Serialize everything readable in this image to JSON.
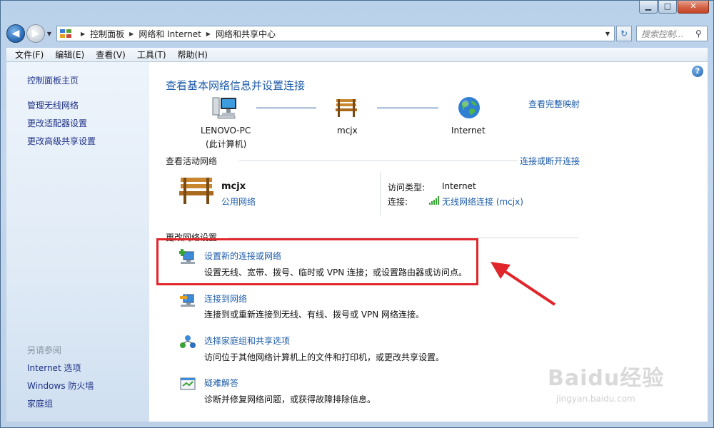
{
  "window": {
    "controls": {
      "minimize": "▁",
      "maximize": "□",
      "close": "✕"
    }
  },
  "navbar": {
    "back": "◀",
    "forward": "▶",
    "breadcrumbs": [
      "控制面板",
      "网络和 Internet",
      "网络和共享中心"
    ],
    "search_placeholder": "搜索控制...",
    "refresh": "↻"
  },
  "menu": [
    "文件(F)",
    "编辑(E)",
    "查看(V)",
    "工具(T)",
    "帮助(H)"
  ],
  "sidebar": {
    "home": "控制面板主页",
    "links": [
      "管理无线网络",
      "更改适配器设置",
      "更改高级共享设置"
    ],
    "see_also_title": "另请参阅",
    "see_also": [
      "Internet 选项",
      "Windows 防火墙",
      "家庭组"
    ]
  },
  "main": {
    "title": "查看基本网络信息并设置连接",
    "full_map_link": "查看完整映射",
    "map": {
      "computer_name": "LENOVO-PC",
      "computer_sub": "(此计算机)",
      "network_name": "mcjx",
      "internet": "Internet"
    },
    "active_networks_label": "查看活动网络",
    "connect_disconnect_link": "连接或断开连接",
    "active": {
      "name": "mcjx",
      "type": "公用网络",
      "access_type_label": "访问类型:",
      "access_type_value": "Internet",
      "connections_label": "连接:",
      "connections_value": "无线网络连接 (mcjx)"
    },
    "change_settings_label": "更改网络设置",
    "tasks": [
      {
        "title": "设置新的连接或网络",
        "desc": "设置无线、宽带、拨号、临时或 VPN 连接；或设置路由器或访问点。"
      },
      {
        "title": "连接到网络",
        "desc": "连接到或重新连接到无线、有线、拨号或 VPN 网络连接。"
      },
      {
        "title": "选择家庭组和共享选项",
        "desc": "访问位于其他网络计算机上的文件和打印机，或更改共享设置。"
      },
      {
        "title": "疑难解答",
        "desc": "诊断并修复网络问题，或获得故障排除信息。"
      }
    ],
    "help": "?"
  },
  "colors": {
    "link": "#1e5ca8",
    "highlight": "#e0262a",
    "sidebar_link": "#1e3287"
  },
  "watermark": {
    "logo": "Baidu经验",
    "url": "jingyan.baidu.com"
  }
}
